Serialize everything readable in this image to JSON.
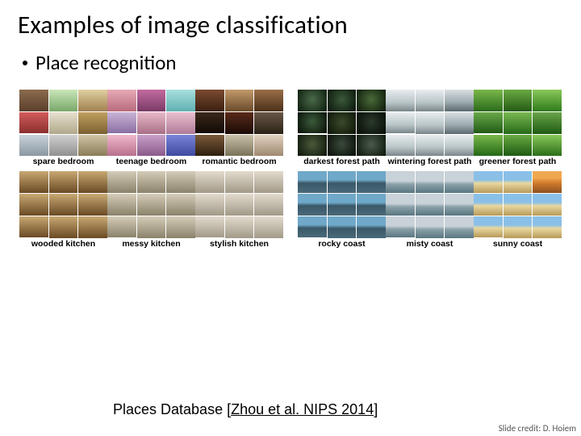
{
  "title": "Examples of image classification",
  "bullet": "Place recognition",
  "left_categories": [
    {
      "label": "spare bedroom"
    },
    {
      "label": "teenage bedroom"
    },
    {
      "label": "romantic bedroom"
    },
    {
      "label": "wooded kitchen"
    },
    {
      "label": "messy kitchen"
    },
    {
      "label": "stylish kitchen"
    }
  ],
  "right_categories": [
    {
      "label": "darkest forest path"
    },
    {
      "label": "wintering forest path"
    },
    {
      "label": "greener forest path"
    },
    {
      "label": "rocky coast"
    },
    {
      "label": "misty coast"
    },
    {
      "label": "sunny coast"
    }
  ],
  "citation": {
    "prefix": "Places Database [",
    "link_text": "Zhou et al. NIPS 2014",
    "suffix": "]"
  },
  "credit": "Slide credit: D. Hoiem"
}
